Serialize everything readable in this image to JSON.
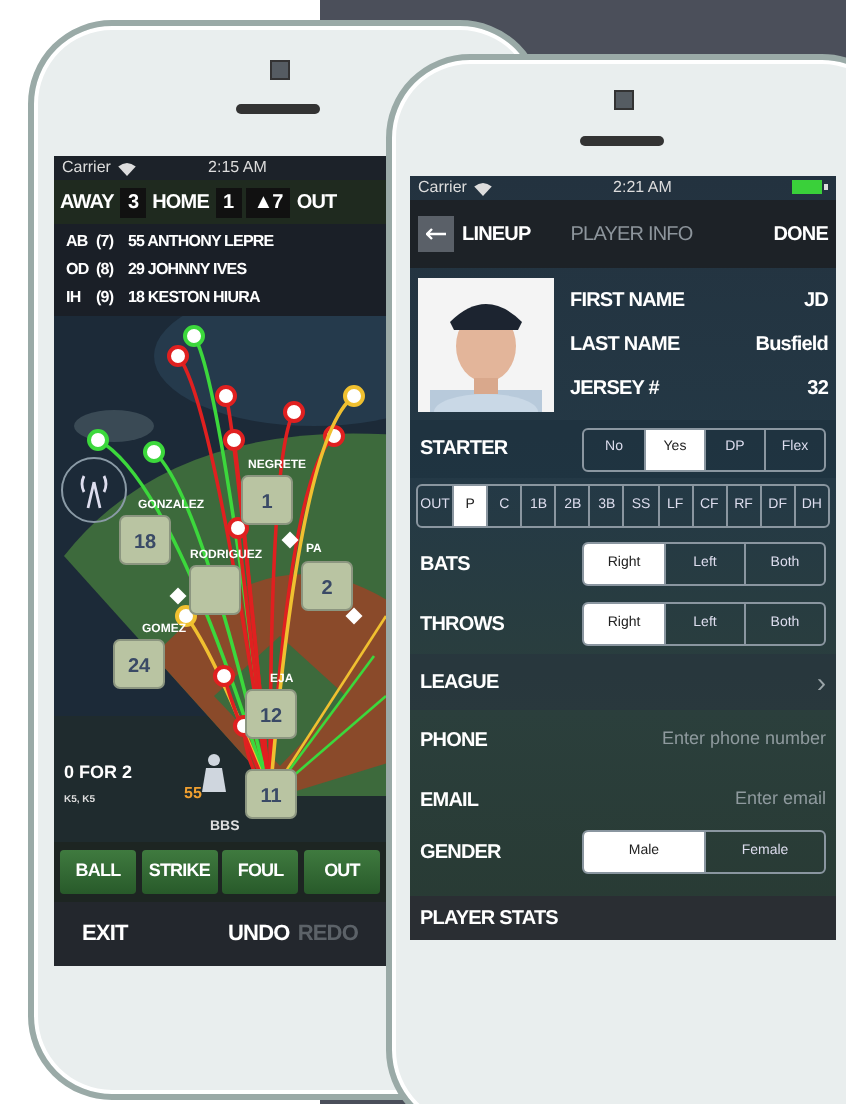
{
  "scoring_screen": {
    "status_bar": {
      "carrier": "Carrier",
      "time": "2:15 AM"
    },
    "scoreboard": {
      "away_label": "AWAY",
      "away_score": "3",
      "home_label": "HOME",
      "home_score": "1",
      "inning": "▲7",
      "outs_label": "OUT"
    },
    "due_up": [
      {
        "code": "AB",
        "order": "(7)",
        "player": "55 ANTHONY LEPRE"
      },
      {
        "code": "OD",
        "order": "(8)",
        "player": "29 JOHNNY IVES"
      },
      {
        "code": "IH",
        "order": "(9)",
        "player": "18 KESTON HIURA"
      }
    ],
    "fielders": [
      {
        "name": "NEGRETE",
        "number": "1"
      },
      {
        "name": "GONZALEZ",
        "number": "18"
      },
      {
        "name": "RODRIGUEZ"
      },
      {
        "name": "PA",
        "number": "2"
      },
      {
        "name": "GOMEZ",
        "number": "24"
      },
      {
        "name": "EJA",
        "number": "12"
      },
      {
        "number": "11"
      }
    ],
    "batter": {
      "record": "0 FOR 2",
      "results": "K5, K5",
      "number": "55",
      "name": "BBS"
    },
    "actions": [
      "BALL",
      "STRIKE",
      "FOUL",
      "OUT"
    ],
    "exit": "EXIT",
    "undo": "UNDO",
    "redo": {
      "label": "REDO",
      "disabled": true
    }
  },
  "player_screen": {
    "status_bar": {
      "carrier": "Carrier",
      "time": "2:21 AM"
    },
    "nav": {
      "back": "LINEUP",
      "title": "PLAYER INFO",
      "done": "DONE"
    },
    "info": [
      {
        "label": "FIRST NAME",
        "value": "JD"
      },
      {
        "label": "LAST NAME",
        "value": "Busfield"
      },
      {
        "label": "JERSEY #",
        "value": "32"
      }
    ],
    "starter": {
      "label": "STARTER",
      "options": [
        {
          "label": "No",
          "selected": false
        },
        {
          "label": "Yes",
          "selected": true
        },
        {
          "label": "DP",
          "selected": false
        },
        {
          "label": "Flex",
          "selected": false
        }
      ]
    },
    "positions": [
      {
        "label": "OUT",
        "selected": false
      },
      {
        "label": "P",
        "selected": true
      },
      {
        "label": "C",
        "selected": false
      },
      {
        "label": "1B",
        "selected": false
      },
      {
        "label": "2B",
        "selected": false
      },
      {
        "label": "3B",
        "selected": false
      },
      {
        "label": "SS",
        "selected": false
      },
      {
        "label": "LF",
        "selected": false
      },
      {
        "label": "CF",
        "selected": false
      },
      {
        "label": "RF",
        "selected": false
      },
      {
        "label": "DF",
        "selected": false
      },
      {
        "label": "DH",
        "selected": false
      }
    ],
    "bats": {
      "label": "BATS",
      "options": [
        {
          "label": "Right",
          "selected": true
        },
        {
          "label": "Left",
          "selected": false
        },
        {
          "label": "Both",
          "selected": false
        }
      ]
    },
    "throws": {
      "label": "THROWS",
      "options": [
        {
          "label": "Right",
          "selected": true
        },
        {
          "label": "Left",
          "selected": false
        },
        {
          "label": "Both",
          "selected": false
        }
      ]
    },
    "league": {
      "label": "LEAGUE",
      "chevron": "›"
    },
    "phone": {
      "label": "PHONE",
      "placeholder": "Enter phone number"
    },
    "email": {
      "label": "EMAIL",
      "placeholder": "Enter email"
    },
    "gender": {
      "label": "GENDER",
      "options": [
        {
          "label": "Male",
          "selected": true
        },
        {
          "label": "Female",
          "selected": false
        }
      ]
    },
    "footer": "PLAYER STATS"
  }
}
